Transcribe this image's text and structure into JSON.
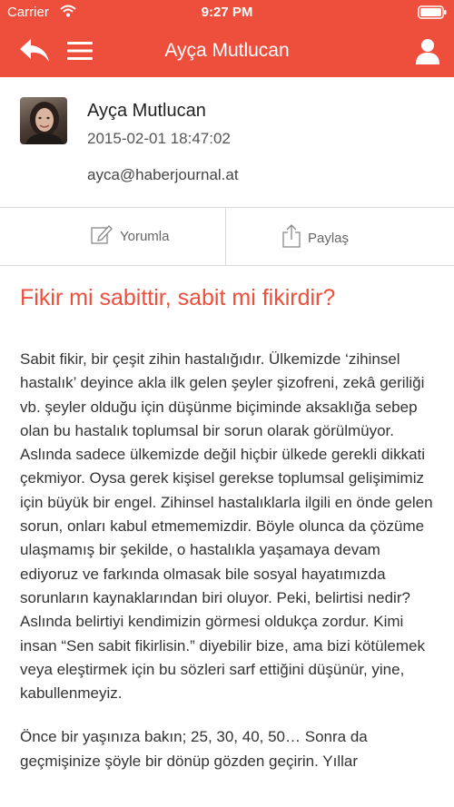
{
  "status_bar": {
    "carrier": "Carrier",
    "time": "9:27 PM"
  },
  "nav": {
    "title": "Ayça Mutlucan",
    "icons": [
      "back-arrow-icon",
      "hamburger-menu-icon",
      "user-profile-icon"
    ],
    "color": "#ee4e3c"
  },
  "author": {
    "name": "Ayça Mutlucan",
    "date": "2015-02-01 18:47:02",
    "email": "ayca@haberjournal.at"
  },
  "actions": {
    "comment_label": "Yorumla",
    "share_label": "Paylaş"
  },
  "article": {
    "title": "Fikir mi sabittir, sabit mi fikirdir?",
    "paragraphs": [
      "Sabit fikir, bir çeşit zihin hastalığıdır. Ülkemizde ‘zihinsel hastalık’ deyince akla ilk gelen şeyler şizofreni, zekâ geriliği vb. şeyler olduğu için düşünme biçiminde aksaklığa sebep olan bu hastalık toplumsal bir sorun olarak görülmüyor. Aslında sadece ülkemizde değil hiçbir ülkede gerekli dikkati çekmiyor. Oysa gerek kişisel gerekse toplumsal gelişimimiz için büyük bir engel. Zihinsel hastalıklarla ilgili en önde gelen sorun, onları kabul etmememizdir. Böyle olunca da çözüme ulaşmamış bir şekilde, o hastalıkla yaşamaya devam ediyoruz ve farkında olmasak bile sosyal hayatımızda sorunların kaynaklarından biri oluyor. Peki, belirtisi nedir? Aslında belirtiyi kendimizin görmesi oldukça zordur. Kimi insan “Sen sabit fikirlisin.” diyebilir bize, ama bizi kötülemek veya eleştirmek için bu sözleri sarf ettiğini düşünür, yine, kabullenmeyiz.",
      "Önce bir yaşınıza bakın; 25, 30, 40, 50… Sonra da geçmişinize şöyle bir dönüp gözden geçirin. Yıllar"
    ]
  }
}
